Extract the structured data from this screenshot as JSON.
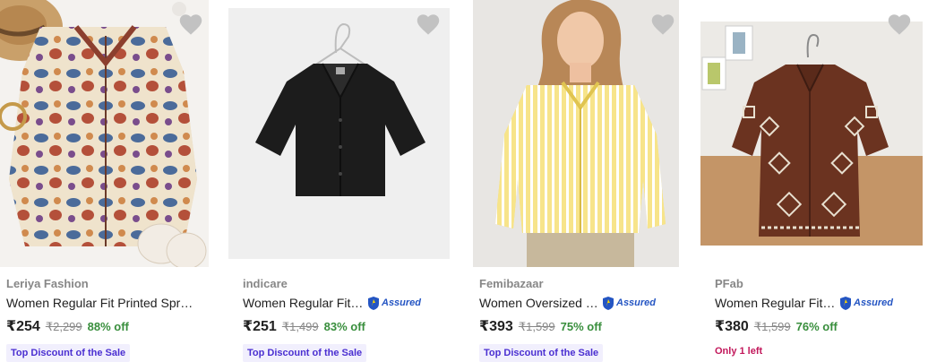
{
  "products": [
    {
      "brand": "Leriya Fashion",
      "title": "Women Regular Fit Printed Spread Collar Casual Shirt",
      "assured": false,
      "assured_label": "",
      "price": "₹254",
      "mrp": "₹2,299",
      "discount": "88% off",
      "badge": "Top Discount of the Sale",
      "stock": "",
      "image_icon": "printed-shirt-image"
    },
    {
      "brand": "indicare",
      "title": "Women Regular Fit Solid Casual Shirt",
      "assured": true,
      "assured_label": "Assured",
      "price": "₹251",
      "mrp": "₹1,499",
      "discount": "83% off",
      "badge": "Top Discount of the Sale",
      "stock": "",
      "image_icon": "black-crop-shirt-image"
    },
    {
      "brand": "Femibazaar",
      "title": "Women Oversized Striped Casual Shirt",
      "assured": true,
      "assured_label": "Assured",
      "price": "₹393",
      "mrp": "₹1,599",
      "discount": "75% off",
      "badge": "Top Discount of the Sale",
      "stock": "",
      "image_icon": "yellow-striped-shirt-image"
    },
    {
      "brand": "PFab",
      "title": "Women Regular Fit Embroidered Casual Shirt",
      "assured": true,
      "assured_label": "Assured",
      "price": "₹380",
      "mrp": "₹1,599",
      "discount": "76% off",
      "badge": "",
      "stock": "Only 1 left",
      "image_icon": "brown-embroidered-shirt-image"
    }
  ],
  "colors": {
    "brand_text": "#878787",
    "discount_green": "#388e3c",
    "badge_purple": "#4a2fd1",
    "assured_blue": "#2455c3",
    "stock_red": "#c2185b",
    "heart_gray": "#c2c2c2"
  }
}
